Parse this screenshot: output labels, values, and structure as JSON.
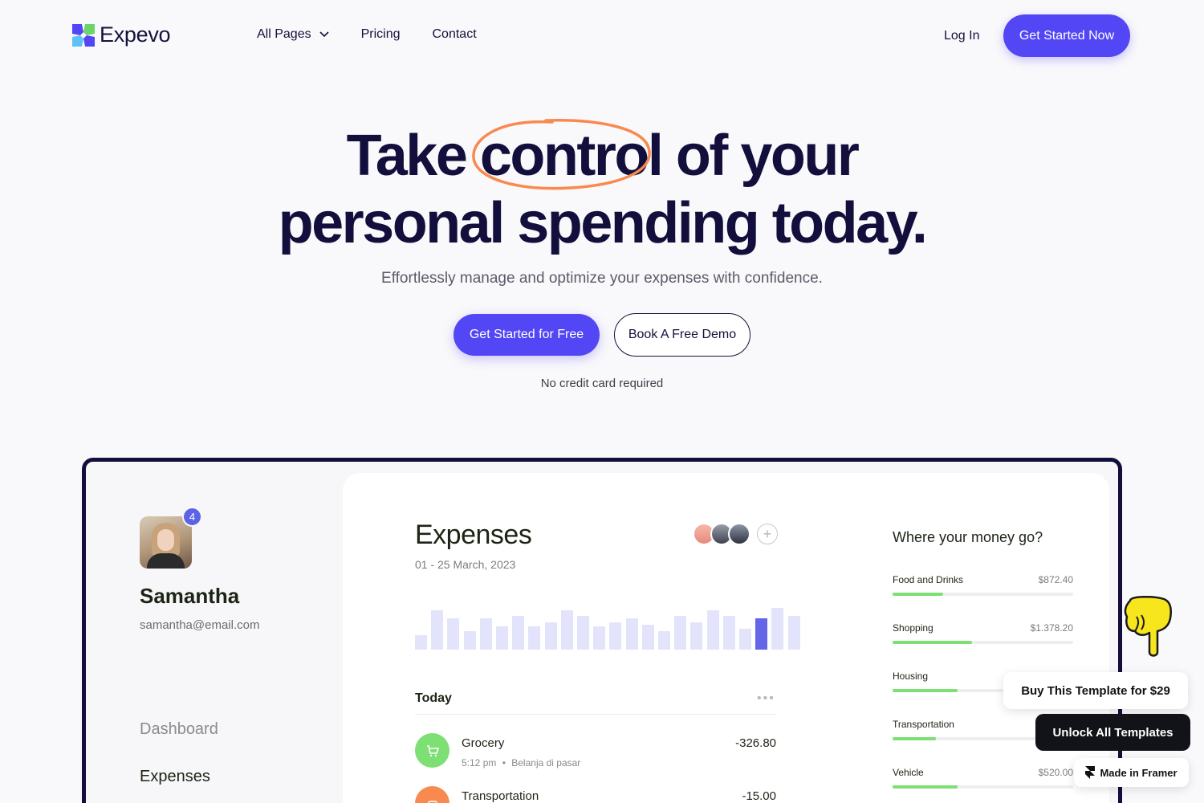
{
  "brand": {
    "name": "Expevo",
    "logo_icon": "expevo-logo-icon",
    "accent": "#5346f4"
  },
  "nav": {
    "links": [
      {
        "label": "All Pages",
        "has_dropdown": true
      },
      {
        "label": "Pricing"
      },
      {
        "label": "Contact"
      }
    ],
    "login_label": "Log In",
    "cta_label": "Get Started Now"
  },
  "hero": {
    "title_line1_pre": "Take",
    "title_line1_circled": "control",
    "title_line1_post": "of your",
    "title_line2": "personal spending today.",
    "subtitle": "Effortlessly manage and optimize your expenses with confidence.",
    "primary_cta": "Get Started for Free",
    "secondary_cta": "Book A Free Demo",
    "note": "No credit card required"
  },
  "dashboard": {
    "user": {
      "name": "Samantha",
      "email": "samantha@email.com",
      "notifications": "4"
    },
    "sidebar": [
      {
        "label": "Dashboard",
        "active": false
      },
      {
        "label": "Expenses",
        "active": true
      }
    ],
    "expenses": {
      "title": "Expenses",
      "date_range": "01 - 25 March, 2023",
      "bar_values": [
        0.35,
        0.95,
        0.75,
        0.45,
        0.75,
        0.55,
        0.8,
        0.55,
        0.65,
        0.95,
        0.8,
        0.55,
        0.65,
        0.75,
        0.6,
        0.45,
        0.8,
        0.65,
        0.95,
        0.8,
        0.5,
        0.75,
        1.0,
        0.8
      ],
      "active_bar_index": 21,
      "today_label": "Today",
      "transactions": [
        {
          "name": "Grocery",
          "time": "5:12 pm",
          "note": "Belanja di pasar",
          "amount": "-326.80",
          "icon": "cart-icon",
          "color": "#7ddf74"
        },
        {
          "name": "Transportation",
          "time": "",
          "note": "",
          "amount": "-15.00",
          "icon": "car-icon",
          "color": "#f88a4f"
        }
      ]
    },
    "money": {
      "title": "Where your money go?",
      "categories": [
        {
          "name": "Food and Drinks",
          "amount": "$872.40",
          "fill": 0.28
        },
        {
          "name": "Shopping",
          "amount": "$1.378.20",
          "fill": 0.44
        },
        {
          "name": "Housing",
          "amount": "",
          "fill": 0.36
        },
        {
          "name": "Transportation",
          "amount": "",
          "fill": 0.24
        },
        {
          "name": "Vehicle",
          "amount": "$520.00",
          "fill": 0.36
        }
      ]
    }
  },
  "promos": {
    "buy_label": "Buy This Template for $29",
    "unlock_label": "Unlock All Templates",
    "framer_label": "Made in Framer"
  }
}
